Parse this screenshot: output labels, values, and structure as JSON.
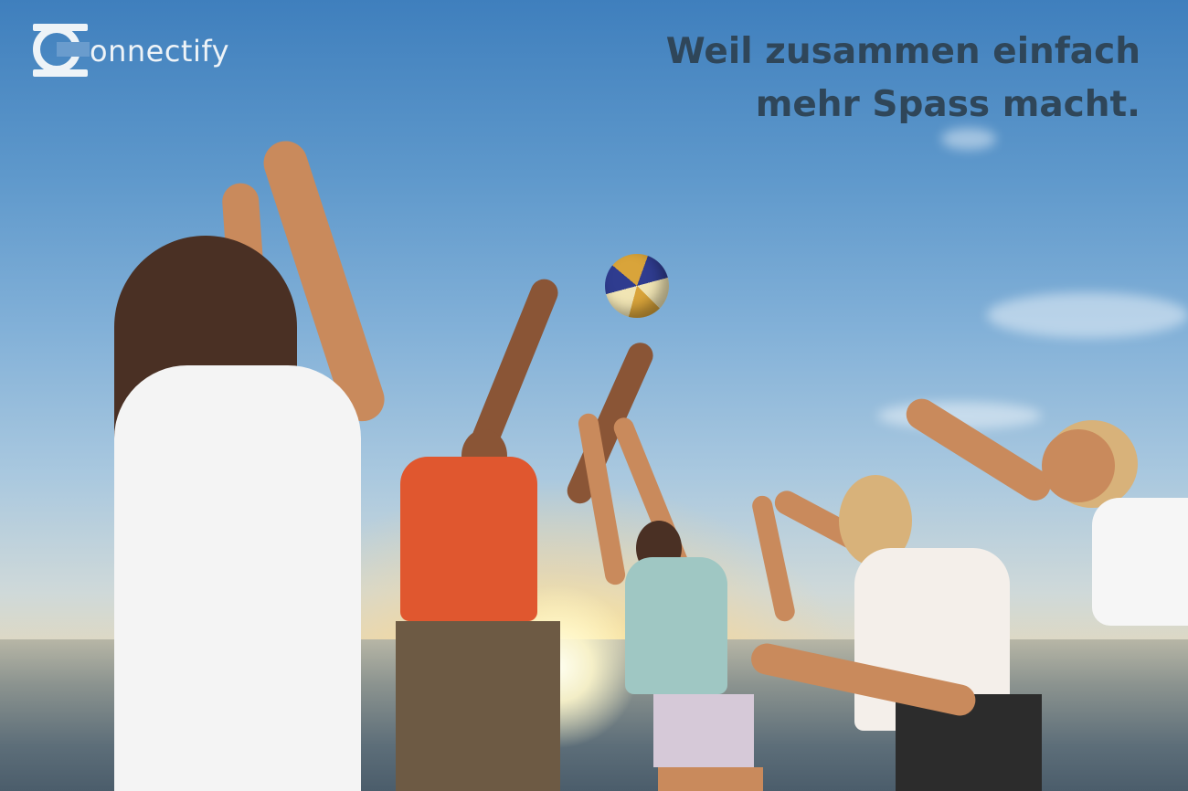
{
  "brand": {
    "logo_text": "onnectify",
    "logo_icon": "connectify-c-icon"
  },
  "headline": {
    "line1": "Weil zusammen einfach",
    "line2": "mehr Spass macht."
  },
  "colors": {
    "headline": "#2f4659",
    "logo": "#eef3f7",
    "sky_top": "#3f7fbd",
    "sun": "#fff8cc"
  }
}
